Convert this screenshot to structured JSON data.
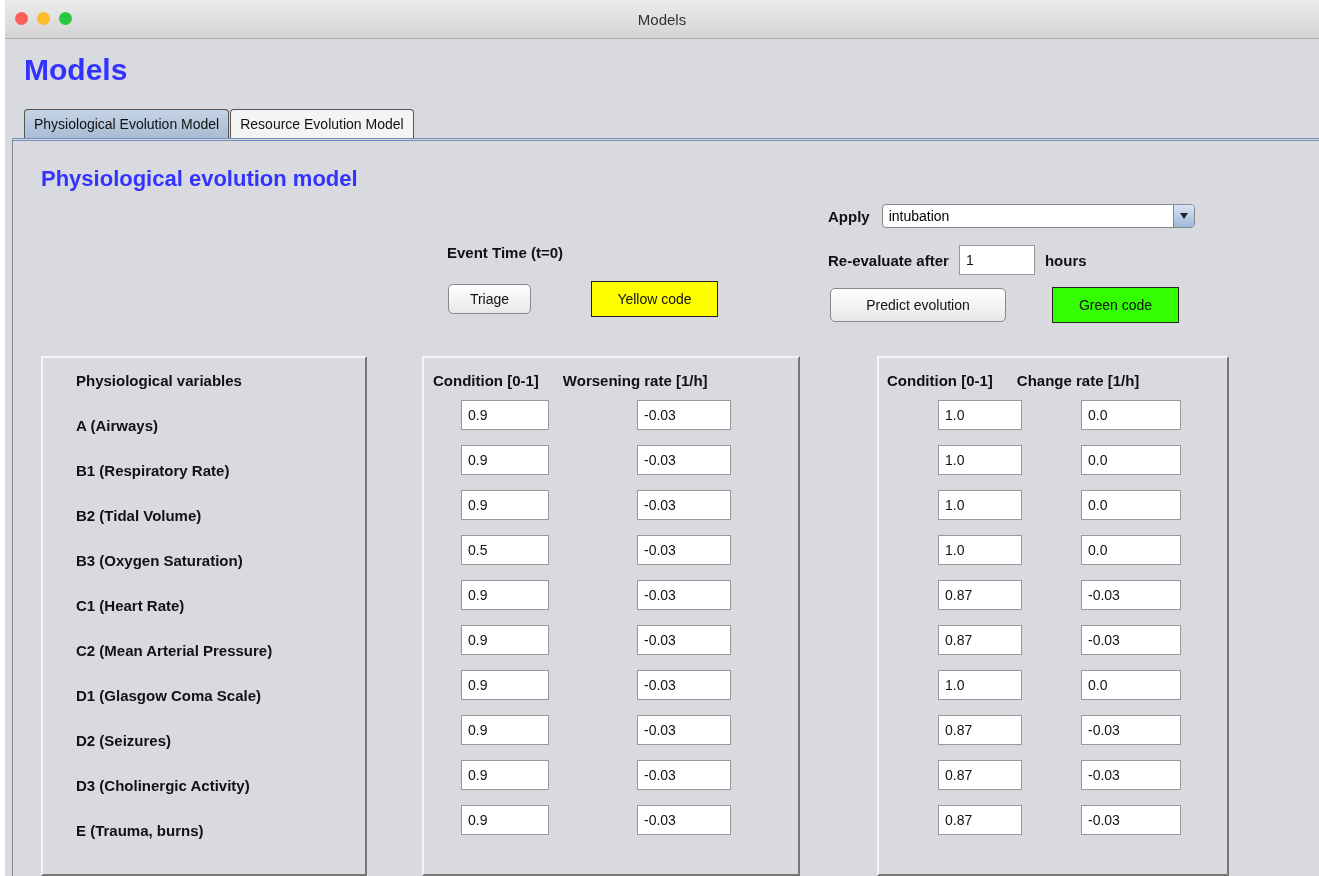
{
  "window": {
    "title": "Models"
  },
  "heading": "Models",
  "tabs": [
    {
      "label": "Physiological Evolution Model",
      "selected": true
    },
    {
      "label": "Resource Evolution Model",
      "selected": false
    }
  ],
  "section_title": "Physiological evolution model",
  "apply": {
    "label": "Apply",
    "value": "intubation"
  },
  "reevaluate": {
    "label": "Re-evaluate after",
    "value": "1",
    "unit": "hours"
  },
  "event_time": "Event Time (t=0)",
  "triage_button": "Triage",
  "initial_code": {
    "label": "Yellow code",
    "color": "#ffff00"
  },
  "predict_button": "Predict evolution",
  "predicted_code": {
    "label": "Green code",
    "color": "#33ff00"
  },
  "variables_header": "Physiological variables",
  "initial_columns": [
    "Condition [0-1]",
    "Worsening rate [1/h]"
  ],
  "predicted_columns": [
    "Condition [0-1]",
    "Change rate [1/h]"
  ],
  "rows": [
    {
      "name": "A (Airways)",
      "condition": "0.9",
      "rate": "-0.03",
      "new_condition": "1.0",
      "new_rate": "0.0"
    },
    {
      "name": "B1 (Respiratory Rate)",
      "condition": "0.9",
      "rate": "-0.03",
      "new_condition": "1.0",
      "new_rate": "0.0"
    },
    {
      "name": "B2 (Tidal Volume)",
      "condition": "0.9",
      "rate": "-0.03",
      "new_condition": "1.0",
      "new_rate": "0.0"
    },
    {
      "name": "B3 (Oxygen Saturation)",
      "condition": "0.5",
      "rate": "-0.03",
      "new_condition": "1.0",
      "new_rate": "0.0"
    },
    {
      "name": "C1 (Heart Rate)",
      "condition": "0.9",
      "rate": "-0.03",
      "new_condition": "0.87",
      "new_rate": "-0.03"
    },
    {
      "name": "C2 (Mean Arterial Pressure)",
      "condition": "0.9",
      "rate": "-0.03",
      "new_condition": "0.87",
      "new_rate": "-0.03"
    },
    {
      "name": "D1 (Glasgow Coma Scale)",
      "condition": "0.9",
      "rate": "-0.03",
      "new_condition": "1.0",
      "new_rate": "0.0"
    },
    {
      "name": "D2 (Seizures)",
      "condition": "0.9",
      "rate": "-0.03",
      "new_condition": "0.87",
      "new_rate": "-0.03"
    },
    {
      "name": "D3 (Cholinergic Activity)",
      "condition": "0.9",
      "rate": "-0.03",
      "new_condition": "0.87",
      "new_rate": "-0.03"
    },
    {
      "name": "E (Trauma, burns)",
      "condition": "0.9",
      "rate": "-0.03",
      "new_condition": "0.87",
      "new_rate": "-0.03"
    }
  ]
}
